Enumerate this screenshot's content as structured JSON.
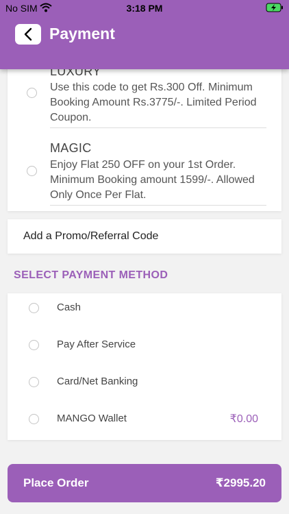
{
  "status_bar": {
    "carrier": "No SIM",
    "time": "3:18 PM"
  },
  "header": {
    "title": "Payment",
    "back_icon": "chevron-left-icon"
  },
  "coupons": [
    {
      "code": "LUXURY",
      "description": "Use this code to get Rs.300 Off. Minimum Booking Amount Rs.3775/-. Limited Period Coupon."
    },
    {
      "code": "MAGIC",
      "description": "Enjoy Flat 250 OFF on your 1st Order. Minimum Booking amount 1599/-. Allowed Only Once Per Flat."
    }
  ],
  "promo": {
    "label": "Add a Promo/Referral Code"
  },
  "payment_section": {
    "title": "SELECT PAYMENT METHOD"
  },
  "payment_methods": [
    {
      "label": "Cash"
    },
    {
      "label": "Pay After Service"
    },
    {
      "label": "Card/Net Banking"
    },
    {
      "label": "MANGO Wallet",
      "amount": "₹0.00"
    }
  ],
  "place_order": {
    "label": "Place Order",
    "total": "₹2995.20"
  },
  "colors": {
    "accent": "#9b5fb8",
    "background": "#f2f2f2"
  }
}
